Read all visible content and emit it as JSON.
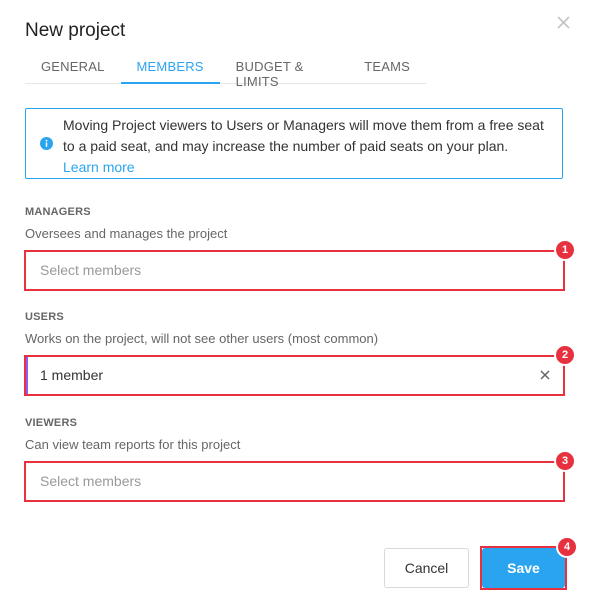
{
  "dialog": {
    "title": "New project",
    "close_icon": "close-icon"
  },
  "tabs": [
    {
      "label": "GENERAL"
    },
    {
      "label": "MEMBERS",
      "active": true
    },
    {
      "label": "BUDGET & LIMITS"
    },
    {
      "label": "TEAMS"
    }
  ],
  "info": {
    "icon": "info-icon",
    "text": "Moving Project viewers to Users or Managers will move them from a free seat to a paid seat, and may increase the number of paid seats on your plan.",
    "link": "Learn more"
  },
  "managers": {
    "label": "MANAGERS",
    "description": "Oversees and manages the project",
    "placeholder": "Select members",
    "badge": "1"
  },
  "users": {
    "label": "USERS",
    "description": "Works on the project, will not see other users (most common)",
    "value": "1 member",
    "badge": "2"
  },
  "viewers": {
    "label": "VIEWERS",
    "description": "Can view team reports for this project",
    "placeholder": "Select members",
    "badge": "3"
  },
  "footer": {
    "cancel_label": "Cancel",
    "save_label": "Save",
    "save_badge": "4"
  },
  "colors": {
    "accent": "#2ba4f0",
    "highlight": "#e8313f",
    "filled_indicator": "#8b5cf6"
  }
}
